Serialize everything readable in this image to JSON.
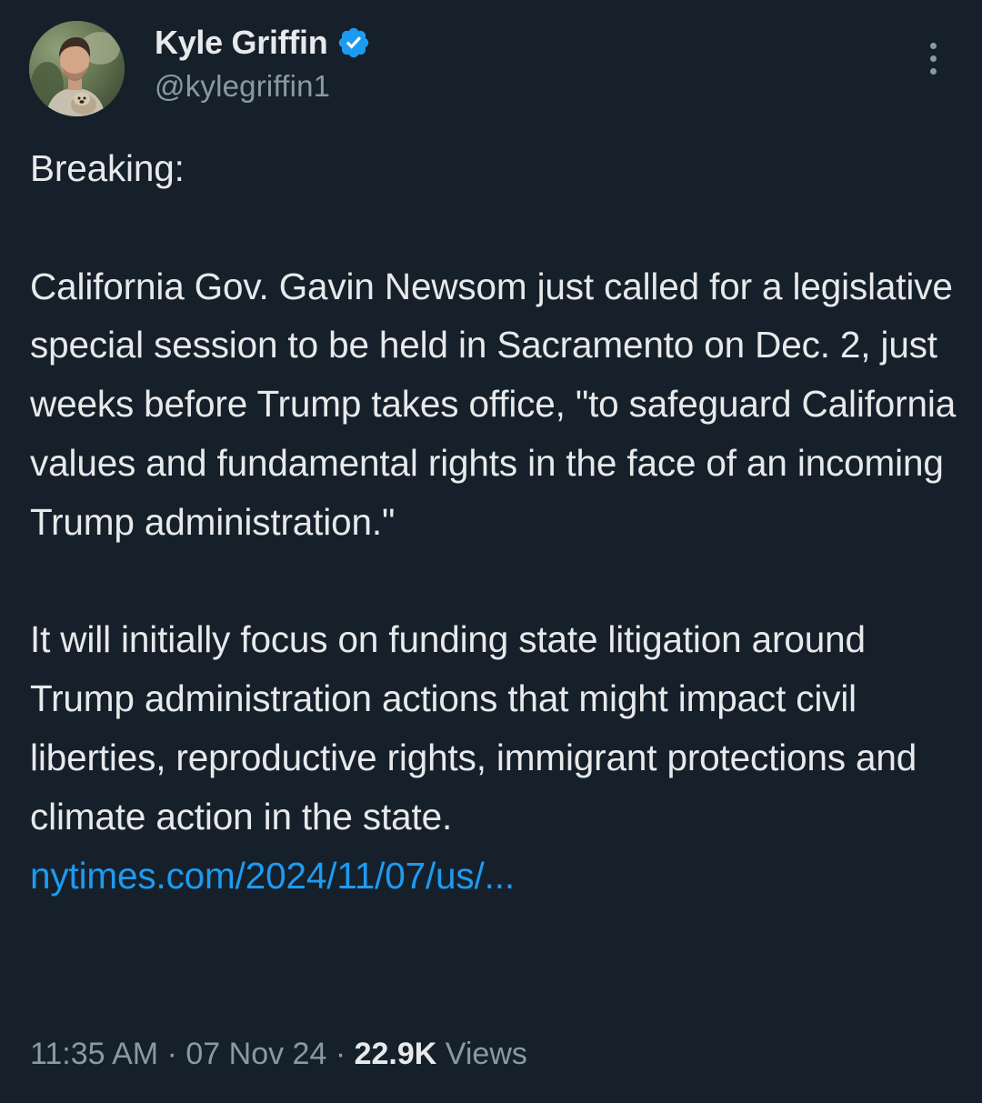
{
  "author": {
    "display_name": "Kyle Griffin",
    "handle": "@kylegriffin1",
    "verified_icon": "verified-badge-icon",
    "avatar": "profile-photo",
    "verified_color": "#1d9bf0"
  },
  "tweet": {
    "paragraphs": [
      "Breaking:",
      "California Gov. Gavin Newsom just called for a legislative special session to be held in Sacramento on Dec. 2, just weeks before Trump takes office, \"to safeguard California values and fundamental rights in the face of an incoming Trump administration.\"",
      "It will initially focus on funding state litigation around Trump administration actions that might impact civil liberties, reproductive rights, immigrant protections and climate action in the state."
    ],
    "link_text": "nytimes.com/2024/11/07/us/..."
  },
  "meta": {
    "time": "11:35 AM",
    "separator": "·",
    "date": "07 Nov 24",
    "views_count": "22.9K",
    "views_label": "Views"
  },
  "colors": {
    "background": "#16202b",
    "text": "#e7e9ea",
    "secondary_text": "#8b98a5",
    "link": "#1d9bf0"
  },
  "icons": {
    "more_menu": "more-vertical-icon"
  }
}
